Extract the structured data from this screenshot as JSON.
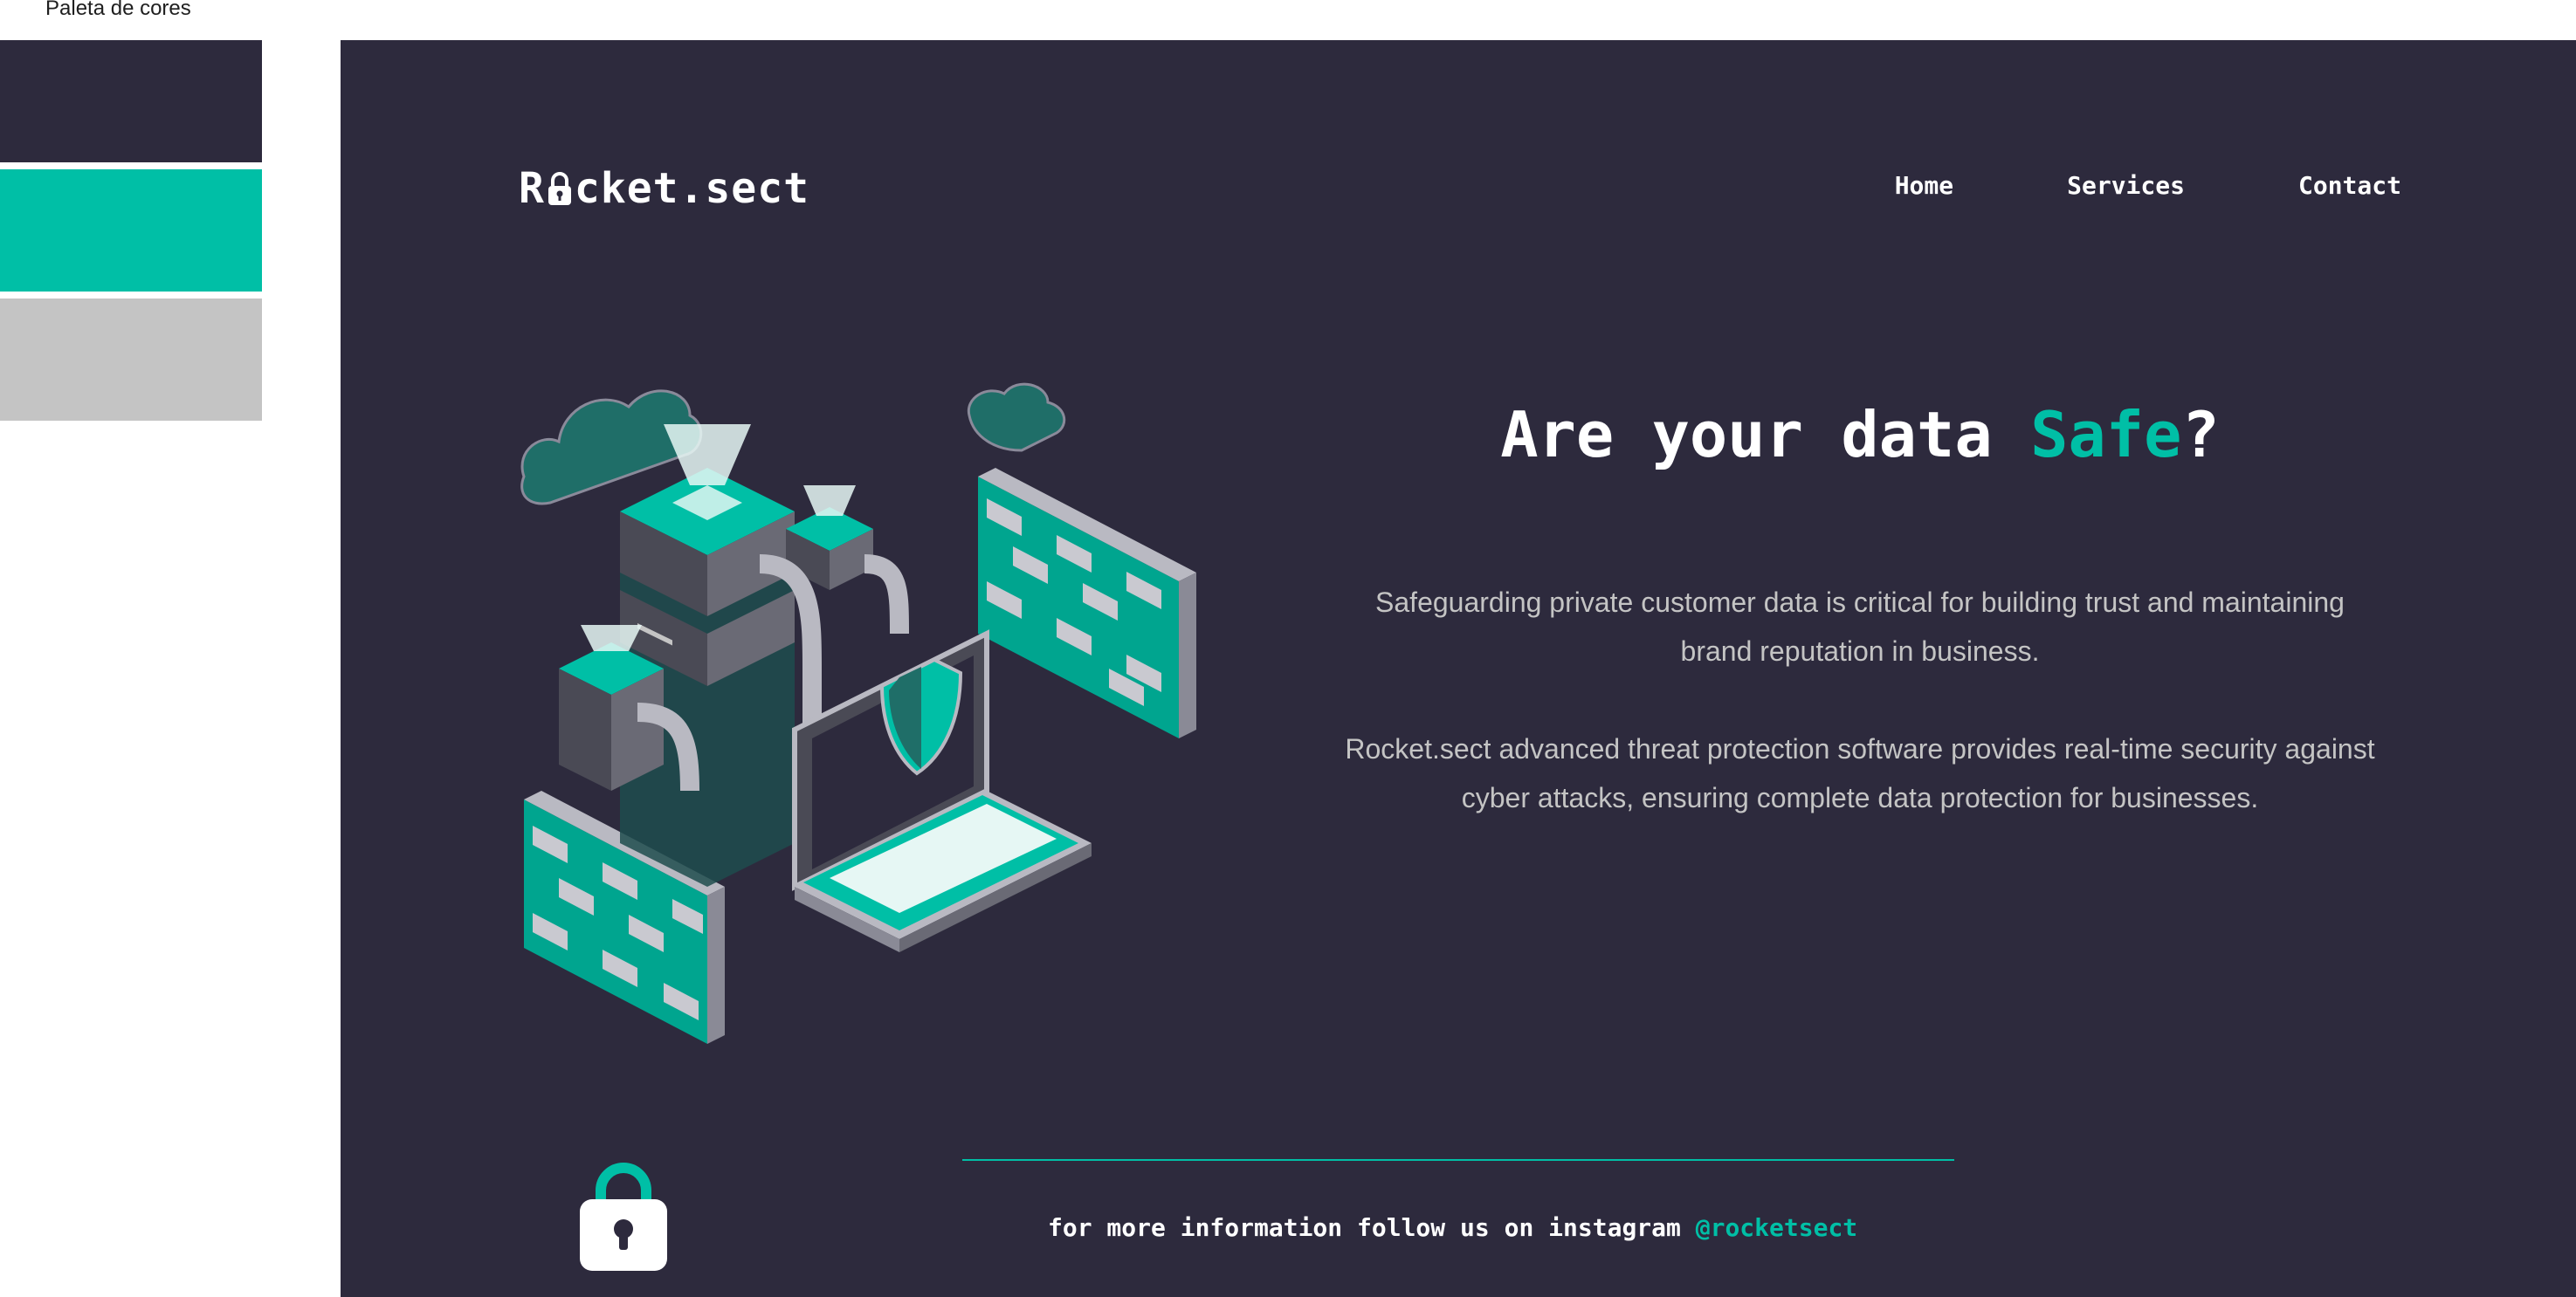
{
  "palette": {
    "label": "Paleta de cores",
    "colors": [
      "#2d2a3d",
      "#00bfa6",
      "#c4c4c4"
    ]
  },
  "header": {
    "logo_prefix": "R",
    "logo_suffix": "cket.sect",
    "logo_icon": "padlock-icon",
    "nav": [
      {
        "label": "Home"
      },
      {
        "label": "Services"
      },
      {
        "label": "Contact"
      }
    ]
  },
  "hero": {
    "title_prefix": "Are your data ",
    "title_accent": "Safe",
    "title_suffix": "?",
    "paragraph_1": "Safeguarding private customer data is critical for building trust and maintaining brand reputation in business.",
    "paragraph_2": "Rocket.sect advanced threat protection software provides real-time security against cyber attacks, ensuring complete data protection for businesses.",
    "illustration_icon": "cyber-security-illustration"
  },
  "footer": {
    "text": "for more information follow us on instagram ",
    "handle": "@rocketsect",
    "icon": "padlock-icon"
  },
  "colors": {
    "background": "#2d2a3d",
    "accent": "#00bfa6",
    "muted": "#c4c4c4"
  }
}
